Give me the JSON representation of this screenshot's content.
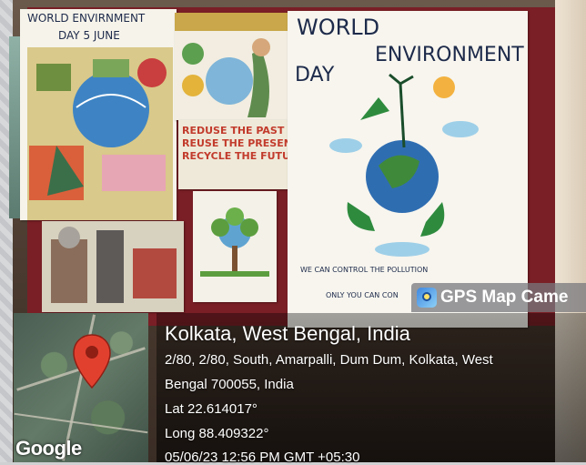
{
  "posters": {
    "left_title_1": "WORLD ENVIRNMENT",
    "left_title_2": "DAY 5 JUNE",
    "middle_slogan_1": "REDUSE THE PAST",
    "middle_slogan_2": "REUSE THE PRESENT",
    "middle_slogan_3": "RECYCLE THE FUTURE",
    "right_title_1": "WORLD",
    "right_title_2": "ENVIRONMENT",
    "right_title_3": "DAY",
    "right_caption_1": "WE CAN CONTROL THE POLLUTION",
    "right_caption_2": "ONLY YOU CAN CON"
  },
  "overlay": {
    "badge_label": "GPS Map Came",
    "location": "Kolkata, West Bengal, India",
    "address_line_1": "2/80, 2/80, South, Amarpalli, Dum Dum, Kolkata, West",
    "address_line_2": "Bengal 700055, India",
    "lat": "Lat 22.614017°",
    "long": "Long 88.409322°",
    "datetime": "05/06/23 12:56 PM GMT +05:30",
    "map_brand": "Google"
  },
  "colors": {
    "pin": "#e2402f",
    "board": "#7a1f26"
  }
}
